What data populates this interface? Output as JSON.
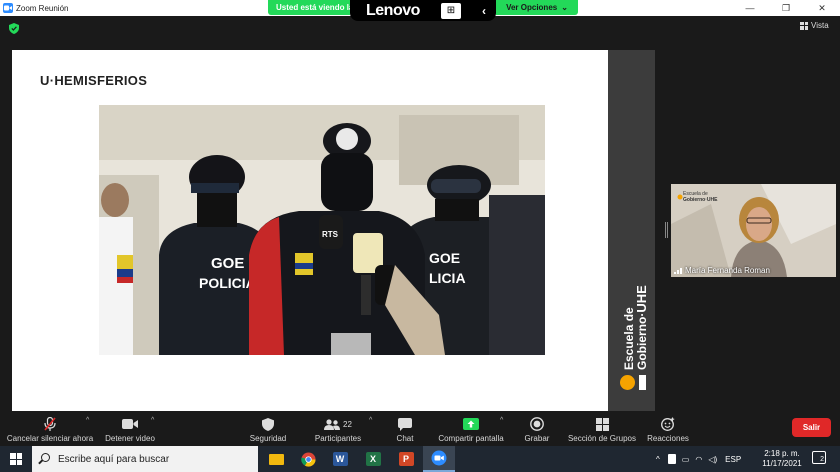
{
  "window": {
    "title": "Zoom Reunión"
  },
  "share_banner": {
    "text": "Usted está viendo la",
    "view_options": "Ver Opciones",
    "view_options_icon": "chevron-down-icon"
  },
  "lenovo_bar": {
    "brand": "Lenovo"
  },
  "header": {
    "view_label": "Vista"
  },
  "slide": {
    "title": "U·HEMISFERIOS"
  },
  "side_band": {
    "line1": "Escuela de",
    "line2": "Gobierno·",
    "brand": "UHE"
  },
  "participant": {
    "name": "María Fernanda Roman",
    "logo_line1": "Escuela de",
    "logo_line2": "Gobierno·UHE"
  },
  "toolbar": {
    "items": [
      {
        "label": "Cancelar silenciar ahora",
        "icon": "microphone-muted-icon"
      },
      {
        "label": "Detener video",
        "icon": "video-camera-icon"
      },
      {
        "label": "Seguridad",
        "icon": "shield-icon"
      },
      {
        "label": "Participantes",
        "icon": "participants-icon",
        "count": "22"
      },
      {
        "label": "Chat",
        "icon": "chat-icon"
      },
      {
        "label": "Compartir pantalla",
        "icon": "share-screen-icon"
      },
      {
        "label": "Grabar",
        "icon": "record-icon"
      },
      {
        "label": "Sección de Grupos",
        "icon": "breakout-rooms-icon"
      },
      {
        "label": "Reacciones",
        "icon": "reactions-icon"
      }
    ],
    "leave": "Salir"
  },
  "taskbar": {
    "search_placeholder": "Escribe aquí para buscar",
    "apps": [
      {
        "name": "file-explorer-icon",
        "letter": ""
      },
      {
        "name": "chrome-icon",
        "letter": ""
      },
      {
        "name": "word-icon",
        "letter": "W"
      },
      {
        "name": "excel-icon",
        "letter": "X"
      },
      {
        "name": "powerpoint-icon",
        "letter": "P"
      },
      {
        "name": "zoom-icon",
        "letter": ""
      }
    ],
    "language": "ESP",
    "time": "2:18 p. m.",
    "date": "11/17/2021",
    "notifications": "2"
  },
  "colors": {
    "zoom_green": "#23d959",
    "leave_red": "#e02828",
    "uhe_orange": "#f5a300",
    "taskbar": "#1f2731"
  }
}
